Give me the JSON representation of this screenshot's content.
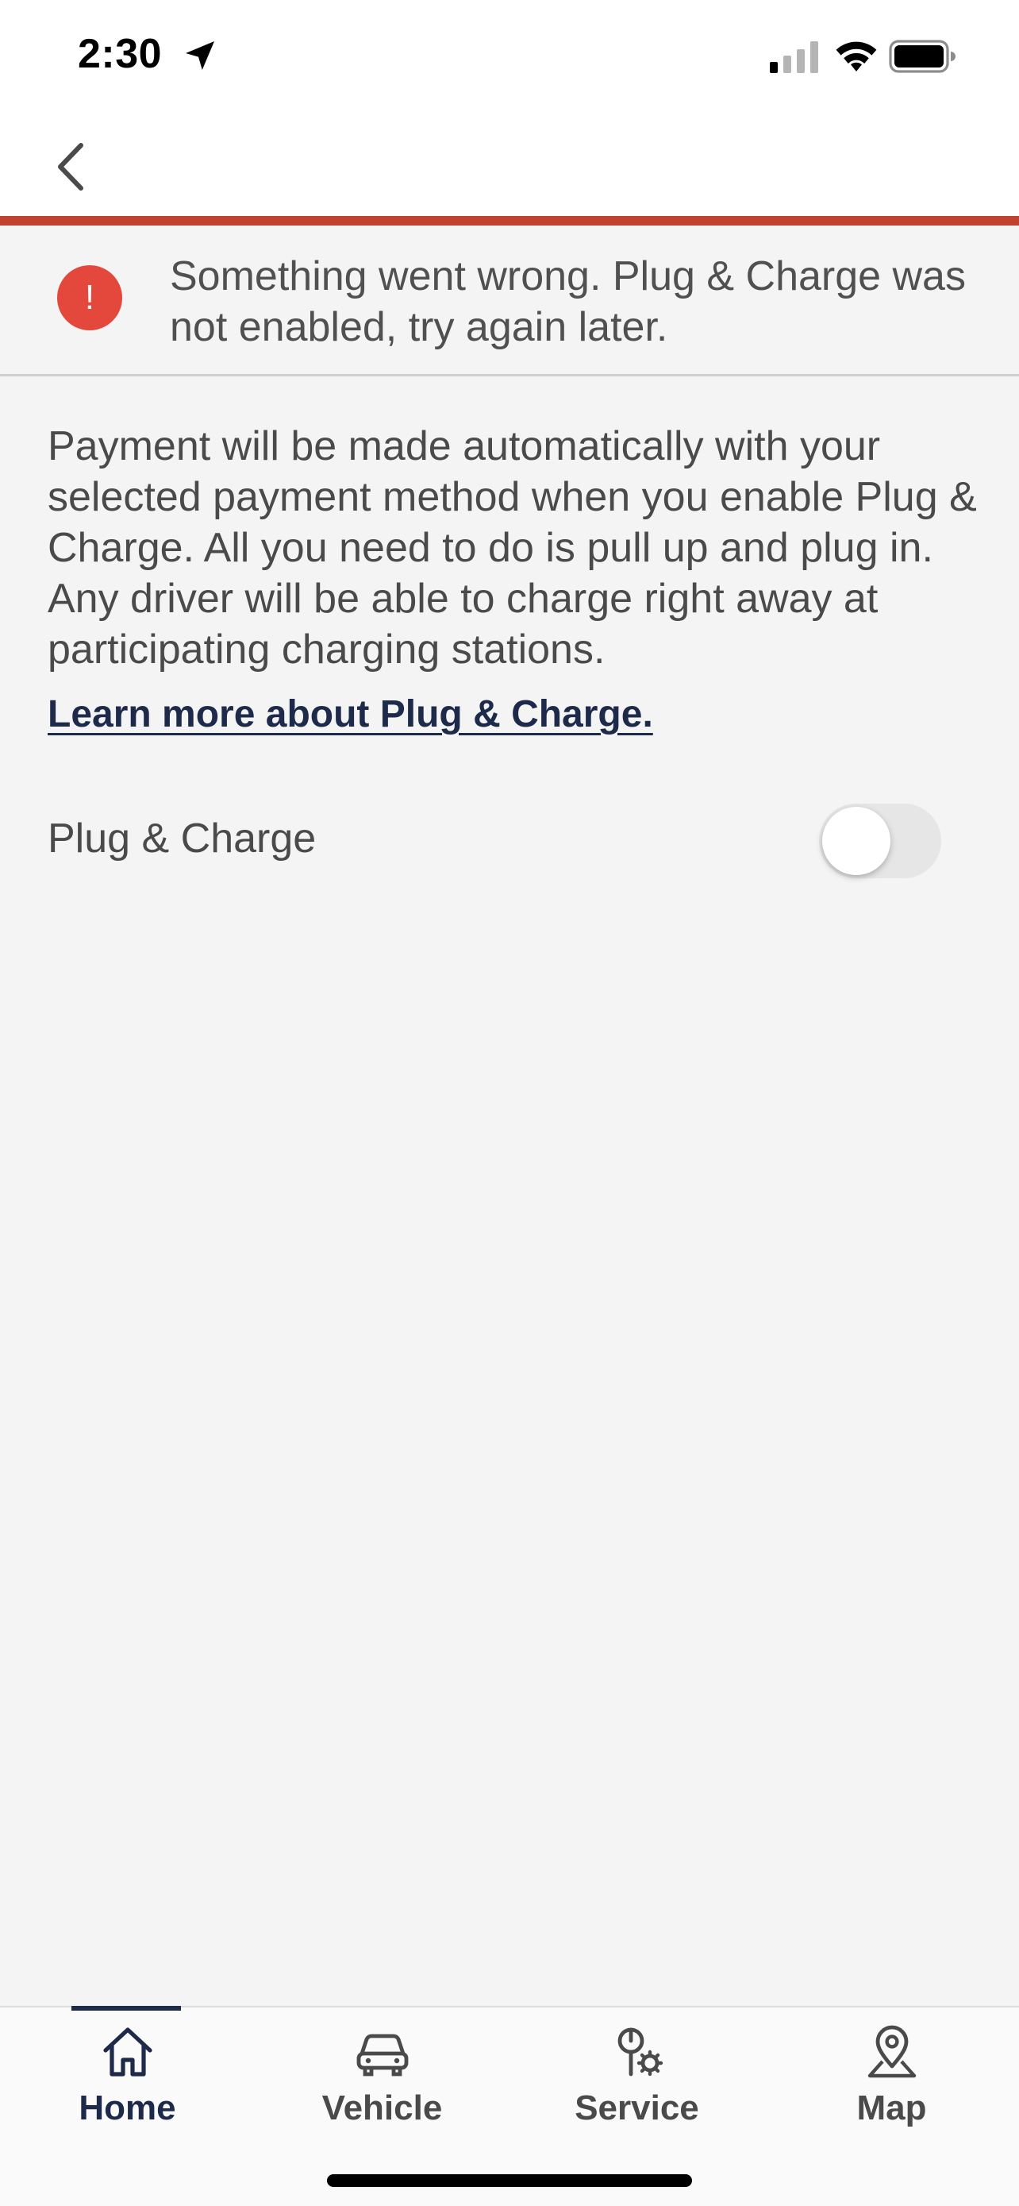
{
  "status_bar": {
    "time": "2:30"
  },
  "banner": {
    "message": "Something went wrong. Plug & Charge was not enabled, try again later.",
    "icon_glyph": "!",
    "icon_color": "#e4473c"
  },
  "content": {
    "description": "Payment will be made automatically with your selected payment method when you enable Plug & Charge. All you need to do is pull up and plug in. Any driver will be able to charge right away at participating charging stations.",
    "learn_more": "Learn more about Plug & Charge.",
    "toggle_label": "Plug & Charge",
    "toggle_on": false
  },
  "tabs": [
    {
      "label": "Home",
      "icon": "home-icon",
      "active": true
    },
    {
      "label": "Vehicle",
      "icon": "car-icon",
      "active": false
    },
    {
      "label": "Service",
      "icon": "service-icon",
      "active": false
    },
    {
      "label": "Map",
      "icon": "map-pin-icon",
      "active": false
    }
  ],
  "colors": {
    "accent_rule": "#c0432f",
    "brand_navy": "#1d2a4a"
  }
}
